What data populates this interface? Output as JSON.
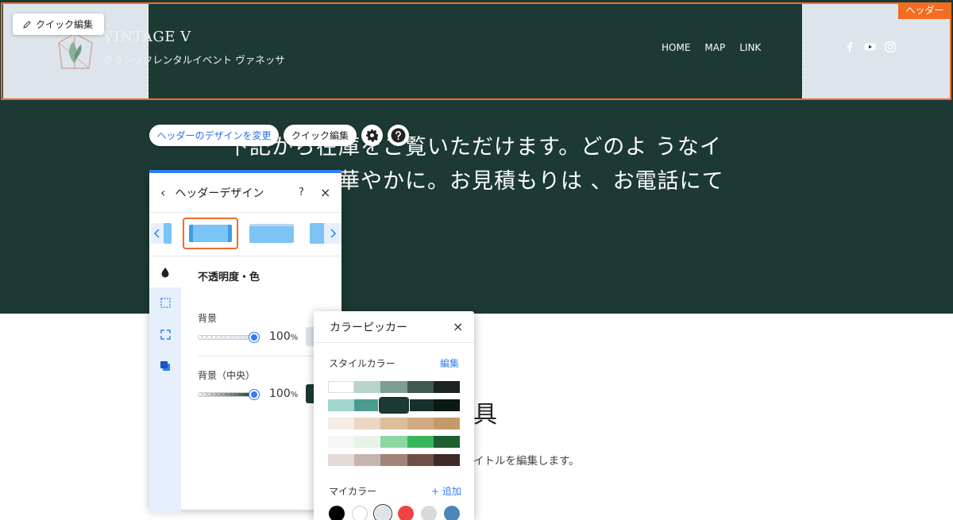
{
  "header": {
    "tag_label": "ヘッダー",
    "quick_edit_label": "クイック編集",
    "site_title": "VINTAGE V",
    "site_subtitle": "クラシックレンタルイベント ヴァネッサ",
    "nav": [
      {
        "label": "HOME"
      },
      {
        "label": "MAP"
      },
      {
        "label": "LINK"
      }
    ],
    "social_icons": [
      "facebook-icon",
      "youtube-icon",
      "instagram-icon"
    ],
    "colors": {
      "band": "#1c3934",
      "side": "#dde4ec",
      "outline": "#ef6d2a"
    }
  },
  "hero": {
    "text": "下記から在庫をご覧いただけます。どのよ うなイベントでも華やかに。お見積もりは 、お電話にて承ります。",
    "change_design_label": "ヘッダーのデザインを変更",
    "quick_edit_label": "クイック編集"
  },
  "content": {
    "title": "具",
    "subtitle": "イトルを編集します。"
  },
  "design_panel": {
    "title": "ヘッダーデザイン",
    "help_label": "?",
    "close_label": "×",
    "back_label": "‹",
    "section_title": "不透明度・色",
    "rows": [
      {
        "label": "背景",
        "percent": "100",
        "unit": "%",
        "color": "#dde4ec"
      },
      {
        "label": "背景（中央）",
        "percent": "100",
        "unit": "%",
        "color": "#1c3934"
      }
    ]
  },
  "color_picker": {
    "title": "カラーピッカー",
    "close_label": "×",
    "style_colors_label": "スタイルカラー",
    "edit_label": "編集",
    "palette": [
      [
        "#ffffff",
        "#b9d3cd",
        "#7d9e93",
        "#3e5a52",
        "#1b2422"
      ],
      [
        "#a3d6cc",
        "#4a9d8e",
        "#1c3934",
        "#17302b",
        "#0c1816"
      ],
      [
        "#f6ece4",
        "#ecd6c4",
        "#ddbd9d",
        "#d1ab81",
        "#c59a6a"
      ],
      [
        "#f6f6f6",
        "#e6f4e8",
        "#8ed7a1",
        "#39b65a",
        "#1e5e30"
      ],
      [
        "#e4dbd8",
        "#c6b5ae",
        "#a28378",
        "#6f4f45",
        "#3e2a26"
      ]
    ],
    "selected": [
      1,
      2
    ],
    "my_colors_label": "マイカラー",
    "add_label": "+ 追加",
    "my_colors": [
      "#000000",
      "#ffffff",
      "#dde4ec",
      "#ef4444",
      "#d9d9d9",
      "#4a86b8"
    ]
  }
}
